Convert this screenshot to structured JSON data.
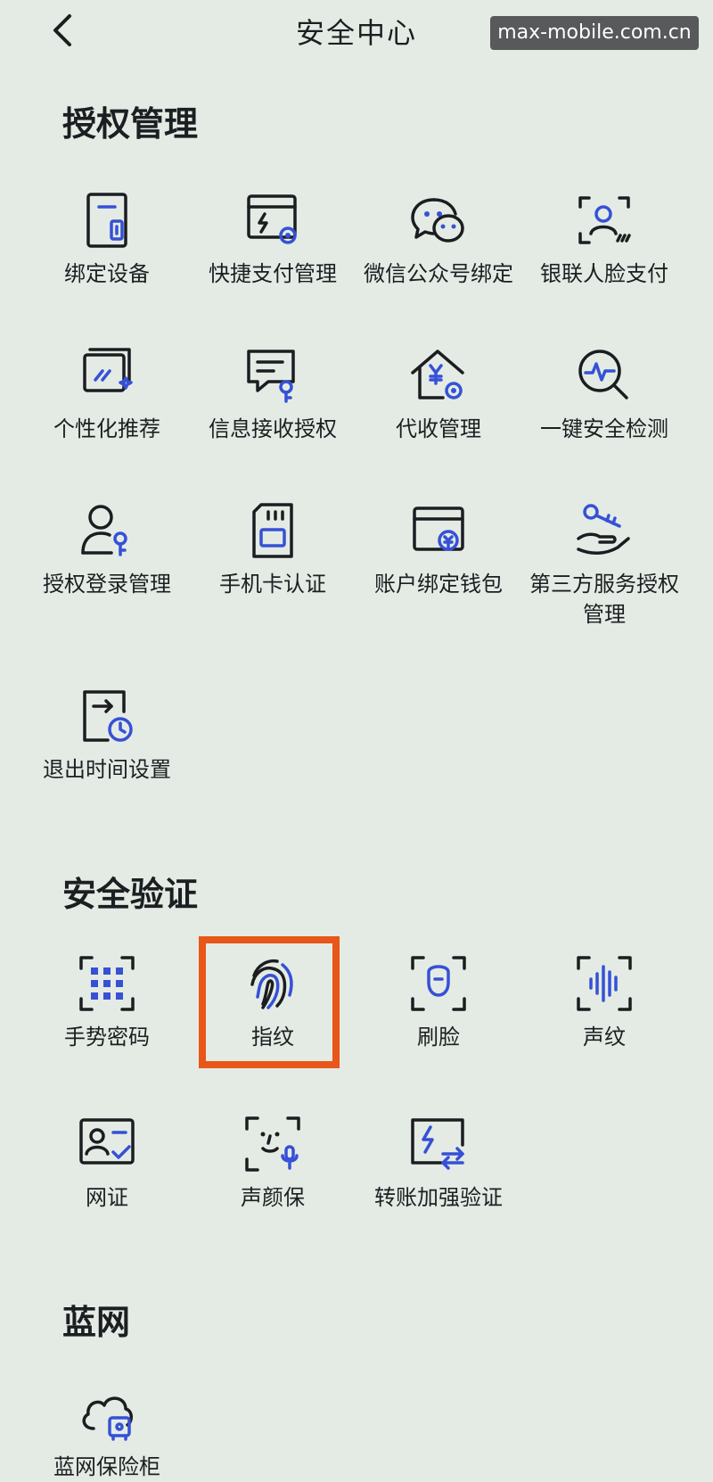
{
  "header": {
    "title": "安全中心",
    "more": "•••",
    "watermark": "max-mobile.com.cn"
  },
  "sections": [
    {
      "title": "授权管理",
      "items": [
        {
          "label": "绑定设备",
          "icon": "bind-device-icon"
        },
        {
          "label": "快捷支付管理",
          "icon": "quick-pay-icon"
        },
        {
          "label": "微信公众号绑定",
          "icon": "wechat-icon"
        },
        {
          "label": "银联人脸支付",
          "icon": "face-pay-icon"
        },
        {
          "label": "个性化推荐",
          "icon": "recommend-icon"
        },
        {
          "label": "信息接收授权",
          "icon": "message-auth-icon"
        },
        {
          "label": "代收管理",
          "icon": "collection-icon"
        },
        {
          "label": "一键安全检测",
          "icon": "security-scan-icon"
        },
        {
          "label": "授权登录管理",
          "icon": "login-auth-icon"
        },
        {
          "label": "手机卡认证",
          "icon": "sim-card-icon"
        },
        {
          "label": "账户绑定钱包",
          "icon": "wallet-icon"
        },
        {
          "label": "第三方服务授权",
          "label2": "管理",
          "icon": "third-party-icon"
        },
        {
          "label": "退出时间设置",
          "icon": "logout-timer-icon"
        }
      ]
    },
    {
      "title": "安全验证",
      "items": [
        {
          "label": "手势密码",
          "icon": "gesture-icon"
        },
        {
          "label": "指纹",
          "icon": "fingerprint-icon"
        },
        {
          "label": "刷脸",
          "icon": "face-scan-icon"
        },
        {
          "label": "声纹",
          "icon": "voiceprint-icon"
        },
        {
          "label": "网证",
          "icon": "net-id-icon"
        },
        {
          "label": "声颜保",
          "icon": "voice-face-icon"
        },
        {
          "label": "转账加强验证",
          "icon": "transfer-verify-icon"
        }
      ]
    },
    {
      "title": "蓝网",
      "items": [
        {
          "label": "蓝网保险柜",
          "icon": "cloud-safe-icon"
        }
      ]
    }
  ],
  "colors": {
    "accent": "#3651d6",
    "highlight": "#e8561a",
    "background": "#e4ebe4"
  }
}
